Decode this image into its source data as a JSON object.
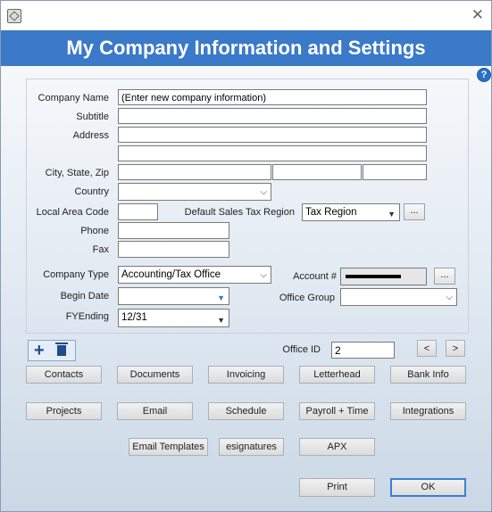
{
  "window": {
    "title": "My Company Information and Settings"
  },
  "form": {
    "company_name": {
      "label": "Company Name",
      "value": "(Enter new company information)"
    },
    "subtitle": {
      "label": "Subtitle",
      "value": ""
    },
    "address": {
      "label": "Address",
      "line1": "",
      "line2": ""
    },
    "city_state_zip": {
      "label": "City, State, Zip",
      "city": "",
      "state": "",
      "zip": ""
    },
    "country": {
      "label": "Country",
      "value": ""
    },
    "local_area_code": {
      "label": "Local Area Code",
      "value": ""
    },
    "default_sales_tax_region": {
      "label": "Default Sales Tax Region",
      "value": "Tax Region"
    },
    "phone": {
      "label": "Phone",
      "value": ""
    },
    "fax": {
      "label": "Fax",
      "value": ""
    },
    "company_type": {
      "label": "Company Type",
      "value": "Accounting/Tax Office"
    },
    "account": {
      "label": "Account #",
      "value": ""
    },
    "begin_date": {
      "label": "Begin Date",
      "value": ""
    },
    "office_group": {
      "label": "Office Group",
      "value": ""
    },
    "fy_ending": {
      "label": "FYEnding",
      "value": "12/31"
    },
    "office_id": {
      "label": "Office ID",
      "value": "2"
    }
  },
  "nav": {
    "prev": "<",
    "next": ">"
  },
  "buttons_row1": [
    "Contacts",
    "Documents",
    "Invoicing",
    "Letterhead",
    "Bank Info"
  ],
  "buttons_row2": [
    "Projects",
    "Email",
    "Schedule",
    "Payroll + Time",
    "Integrations"
  ],
  "buttons_row3": [
    "Email Templates",
    "esignatures",
    "APX"
  ],
  "footer": {
    "print": "Print",
    "ok": "OK"
  },
  "ellipsis": "...",
  "icons": {
    "app": "app-icon",
    "close": "close-icon",
    "help": "help-icon",
    "add": "plus-icon",
    "delete": "trash-icon"
  },
  "colors": {
    "header": "#3b79c9",
    "ok_border": "#3c7fd4"
  }
}
